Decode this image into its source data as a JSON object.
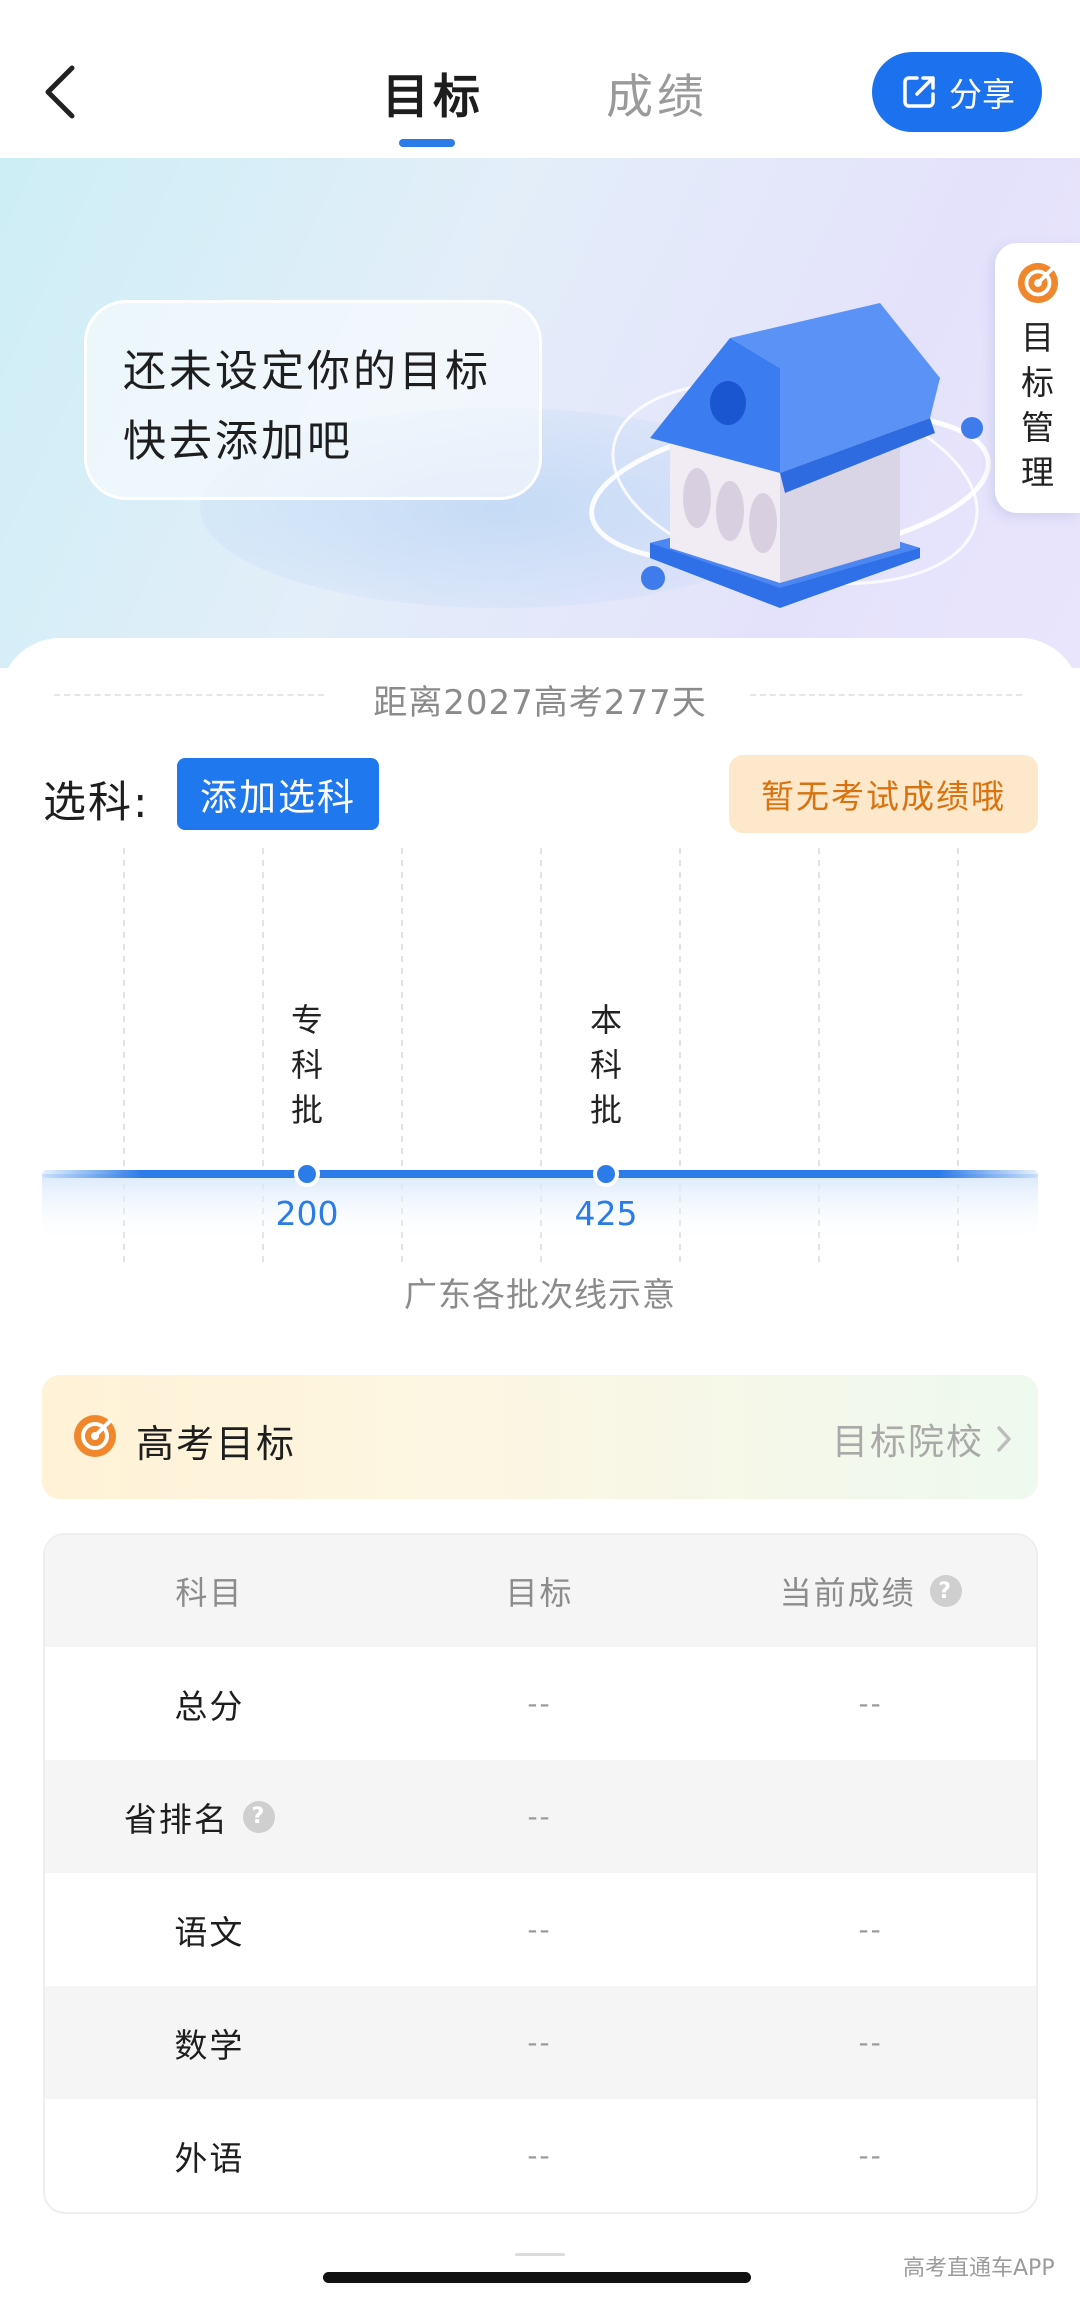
{
  "header": {
    "tabs": [
      {
        "label": "目标",
        "active": true
      },
      {
        "label": "成绩",
        "active": false
      }
    ],
    "share_label": "分享"
  },
  "banner": {
    "message_line1": "还未设定你的目标",
    "message_line2": "快去添加吧",
    "side_manage_chars": [
      "目",
      "标",
      "管",
      "理"
    ]
  },
  "countdown": "距离2027高考277天",
  "subjects": {
    "label": "选科:",
    "add_button": "添加选科",
    "no_score_badge": "暂无考试成绩哦"
  },
  "chart_data": {
    "type": "scatter",
    "markers": [
      {
        "name": [
          "专",
          "科",
          "批"
        ],
        "value": 200
      },
      {
        "name": [
          "本",
          "科",
          "批"
        ],
        "value": 425
      }
    ],
    "caption": "广东各批次线示意",
    "accent_color": "#2b7be8"
  },
  "goal": {
    "title": "高考目标",
    "link_label": "目标院校"
  },
  "table": {
    "headers": [
      "科目",
      "目标",
      "当前成绩"
    ],
    "rows": [
      {
        "subject": "总分",
        "target": "--",
        "current": "--"
      },
      {
        "subject": "省排名",
        "target": "--",
        "current": ""
      },
      {
        "subject": "语文",
        "target": "--",
        "current": "--"
      },
      {
        "subject": "数学",
        "target": "--",
        "current": "--"
      },
      {
        "subject": "外语",
        "target": "--",
        "current": "--"
      }
    ]
  },
  "watermark": "高考直通车APP",
  "colors": {
    "primary": "#1f78ee",
    "badge_bg": "#fde8cc",
    "badge_text": "#d9720f",
    "target_icon": "#f0872c"
  }
}
